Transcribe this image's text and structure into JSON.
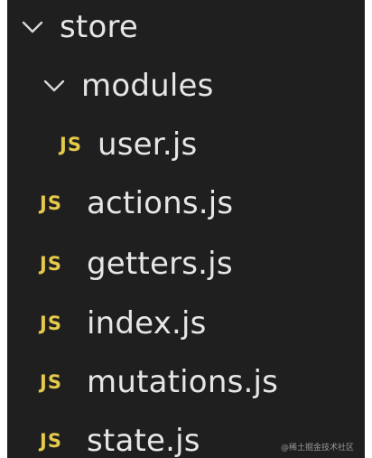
{
  "tree": {
    "folders": [
      {
        "name": "store",
        "expanded": true,
        "icon": "chevron-down-icon"
      },
      {
        "name": "modules",
        "expanded": true,
        "icon": "chevron-down-icon"
      }
    ],
    "module_files": [
      {
        "icon_text": "JS",
        "name": "user.js"
      }
    ],
    "store_files": [
      {
        "icon_text": "JS",
        "name": "actions.js"
      },
      {
        "icon_text": "JS",
        "name": "getters.js"
      },
      {
        "icon_text": "JS",
        "name": "index.js"
      },
      {
        "icon_text": "JS",
        "name": "mutations.js"
      },
      {
        "icon_text": "JS",
        "name": "state.js"
      }
    ]
  },
  "watermark": "@稀土掘金技术社区",
  "colors": {
    "background": "#1f1f1f",
    "text": "#e6e6e6",
    "js_icon": "#e5c94b"
  }
}
